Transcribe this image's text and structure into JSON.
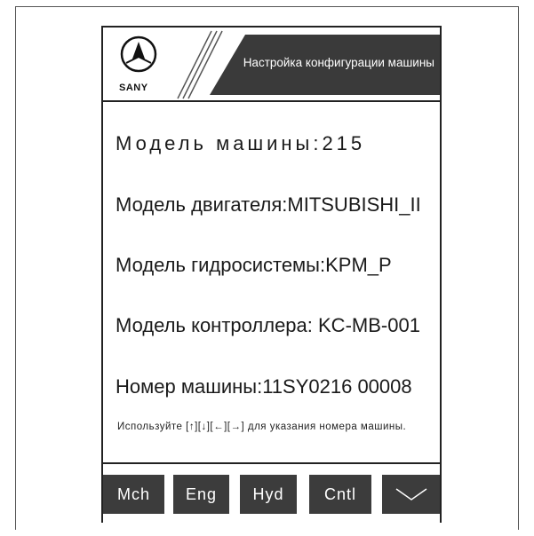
{
  "header": {
    "brand": "SANY",
    "title": "Настройка конфигурации машины"
  },
  "fields": {
    "machine_model": "Модель машины:215",
    "engine_model": "Модель двигателя:MITSUBISHI_II",
    "hydraulic_model": "Модель гидросистемы:KPM_P",
    "controller_model": "Модель контроллера: KC-MB-001",
    "machine_number": "Номер машины:11SY0216 00008"
  },
  "hint": "Используйте [↑][↓][←][→] для указания номера машины.",
  "footer": {
    "buttons": [
      "Mch",
      "Eng",
      "Hyd",
      "Cntl"
    ],
    "confirm_icon": "checkmark-icon"
  },
  "colors": {
    "dark": "#3c3c3c",
    "border": "#222222"
  }
}
